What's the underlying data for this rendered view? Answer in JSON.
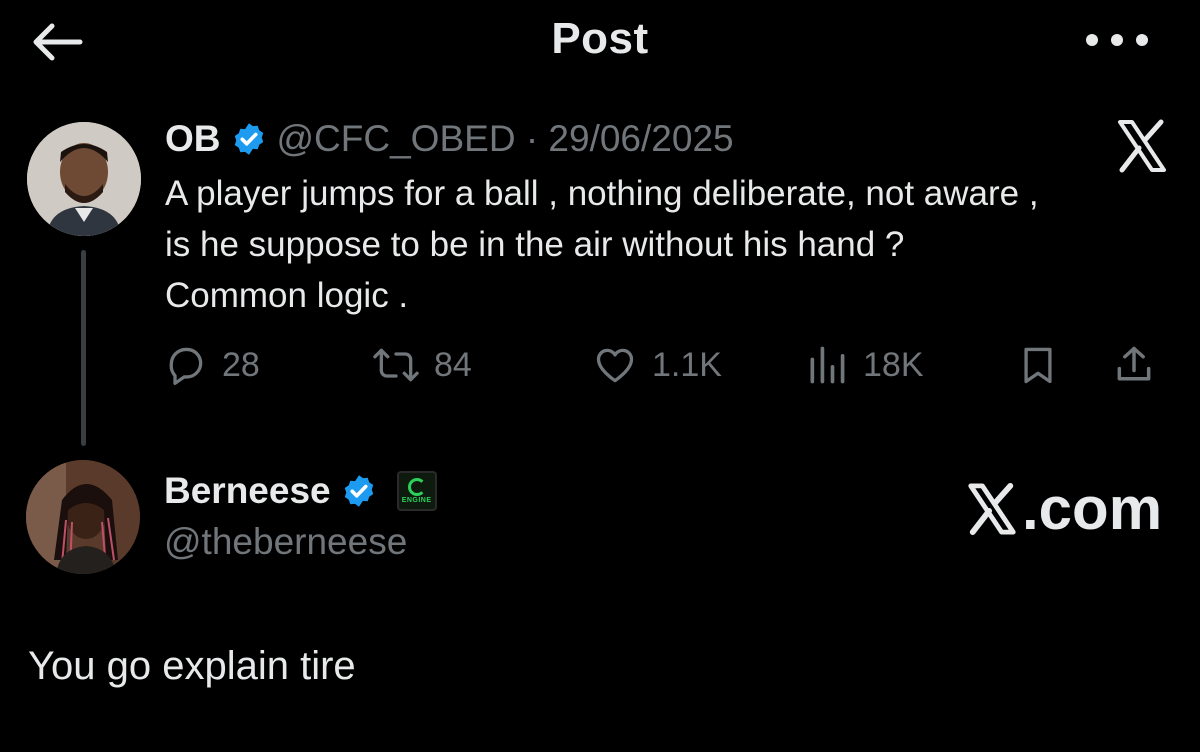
{
  "header": {
    "title": "Post",
    "back_icon": "arrow-left-icon",
    "more_icon": "more-horizontal-icon"
  },
  "post": {
    "author": {
      "name": "OB",
      "verified": true,
      "handle": "@CFC_OBED",
      "date": "29/06/2025",
      "meta": "@CFC_OBED · 29/06/2025"
    },
    "text": "A player jumps for a ball , nothing deliberate, not aware ,\nis he suppose to be in the air without his hand ?\nCommon logic .",
    "platform_icon": "x-logo-icon",
    "actions": {
      "replies": "28",
      "reposts": "84",
      "likes": "1.1K",
      "views": "18K"
    }
  },
  "reply": {
    "author": {
      "name": "Berneese",
      "verified": true,
      "handle": "@theberneese",
      "badge_text": "ENGINE"
    },
    "watermark": ".com",
    "text": "You go explain tire"
  },
  "colors": {
    "background": "#000000",
    "text_primary": "#e7e9ea",
    "text_secondary": "#71767b",
    "verified_blue": "#1d9bf0",
    "thread_line": "#3a3d41"
  }
}
